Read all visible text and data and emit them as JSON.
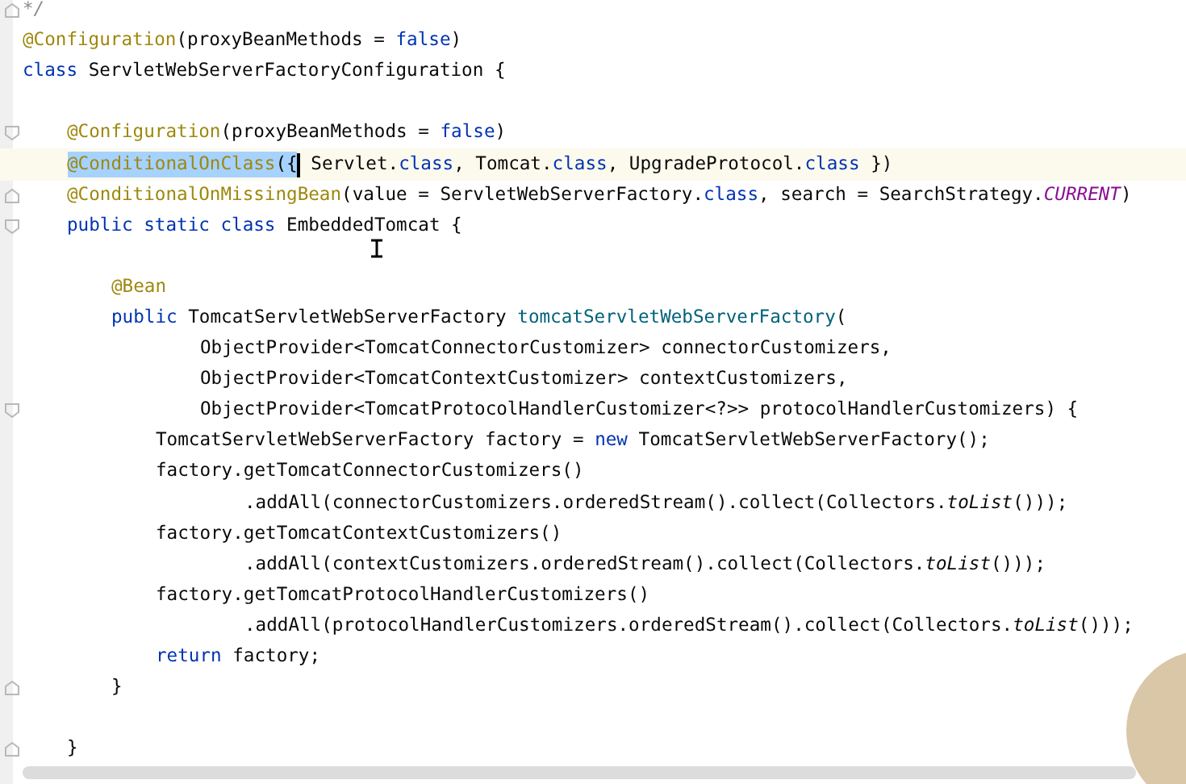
{
  "editor": {
    "lines": [
      {
        "current": false,
        "fold": {
          "kind": "end"
        },
        "tokens": [
          {
            "text": "*/",
            "kind": "comment"
          }
        ]
      },
      {
        "current": false,
        "tokens": [
          {
            "text": "@Configuration",
            "kind": "annotation"
          },
          {
            "text": "(proxyBeanMethods = ",
            "kind": "plain"
          },
          {
            "text": "false",
            "kind": "keyword"
          },
          {
            "text": ")",
            "kind": "plain"
          }
        ]
      },
      {
        "current": false,
        "tokens": [
          {
            "text": "class",
            "kind": "keyword"
          },
          {
            "text": " ServletWebServerFactoryConfiguration {",
            "kind": "plain"
          }
        ],
        "children": [
          {
            "current": false
          },
          {
            "current": false,
            "fold": {
              "kind": "start"
            },
            "tokens": [
              {
                "text": "@Configuration",
                "kind": "annotation"
              },
              {
                "text": "(proxyBeanMethods = ",
                "kind": "plain"
              },
              {
                "text": "false",
                "kind": "keyword"
              },
              {
                "text": ")",
                "kind": "plain"
              }
            ]
          },
          {
            "current": true,
            "selection": [
              {
                "text": "@ConditionalOnClass",
                "kind": "annotation"
              },
              {
                "text": "({",
                "kind": "plain"
              }
            ],
            "tokens": [
              {
                "text": " Servlet.",
                "kind": "plain"
              },
              {
                "text": "class",
                "kind": "keyword"
              },
              {
                "text": ", Tomcat.",
                "kind": "plain"
              },
              {
                "text": "class",
                "kind": "keyword"
              },
              {
                "text": ", UpgradeProtocol.",
                "kind": "plain"
              },
              {
                "text": "class",
                "kind": "keyword"
              },
              {
                "text": " })",
                "kind": "plain"
              }
            ]
          },
          {
            "current": false,
            "fold": {
              "kind": "end"
            },
            "tokens": [
              {
                "text": "@ConditionalOnMissingBean",
                "kind": "annotation"
              },
              {
                "text": "(value = ServletWebServerFactory.",
                "kind": "plain"
              },
              {
                "text": "class",
                "kind": "keyword"
              },
              {
                "text": ", search = SearchStrategy.",
                "kind": "plain"
              },
              {
                "text": "CURRENT",
                "kind": "constant"
              },
              {
                "text": ")",
                "kind": "plain"
              }
            ]
          },
          {
            "current": false,
            "fold": {
              "kind": "start"
            },
            "tokens": [
              {
                "text": "public static class",
                "kind": "keyword"
              },
              {
                "text": " EmbeddedTomcat {",
                "kind": "plain"
              }
            ],
            "children": [
              {
                "current": false
              },
              {
                "current": false,
                "tokens": [
                  {
                    "text": "@Bean",
                    "kind": "annotation"
                  }
                ]
              },
              {
                "current": false,
                "tokens": [
                  {
                    "text": "public",
                    "kind": "keyword"
                  },
                  {
                    "text": " TomcatServletWebServerFactory ",
                    "kind": "plain"
                  },
                  {
                    "text": "tomcatServletWebServerFactory",
                    "kind": "method"
                  },
                  {
                    "text": "(",
                    "kind": "plain"
                  }
                ],
                "continuation": [
                  {
                    "current": false,
                    "tokens": [
                      {
                        "text": "ObjectProvider<TomcatConnectorCustomizer> connectorCustomizers,",
                        "kind": "plain"
                      }
                    ]
                  },
                  {
                    "current": false,
                    "tokens": [
                      {
                        "text": "ObjectProvider<TomcatContextCustomizer> contextCustomizers,",
                        "kind": "plain"
                      }
                    ]
                  },
                  {
                    "current": false,
                    "fold": {
                      "kind": "start"
                    },
                    "tokens": [
                      {
                        "text": "ObjectProvider<TomcatProtocolHandlerCustomizer<?>> protocolHandlerCustomizers) {",
                        "kind": "plain"
                      }
                    ]
                  }
                ],
                "children": [
                  {
                    "current": false,
                    "tokens": [
                      {
                        "text": "TomcatServletWebServerFactory factory = ",
                        "kind": "plain"
                      },
                      {
                        "text": "new",
                        "kind": "keyword"
                      },
                      {
                        "text": " TomcatServletWebServerFactory();",
                        "kind": "plain"
                      }
                    ]
                  },
                  {
                    "current": false,
                    "tokens": [
                      {
                        "text": "factory.getTomcatConnectorCustomizers()",
                        "kind": "plain"
                      }
                    ],
                    "continuation": [
                      {
                        "current": false,
                        "tokens": [
                          {
                            "text": ".addAll(connectorCustomizers.orderedStream().collect(Collectors.",
                            "kind": "plain"
                          },
                          {
                            "text": "toList",
                            "kind": "static-call"
                          },
                          {
                            "text": "()));",
                            "kind": "plain"
                          }
                        ]
                      }
                    ]
                  },
                  {
                    "current": false,
                    "tokens": [
                      {
                        "text": "factory.getTomcatContextCustomizers()",
                        "kind": "plain"
                      }
                    ],
                    "continuation": [
                      {
                        "current": false,
                        "tokens": [
                          {
                            "text": ".addAll(contextCustomizers.orderedStream().collect(Collectors.",
                            "kind": "plain"
                          },
                          {
                            "text": "toList",
                            "kind": "static-call"
                          },
                          {
                            "text": "()));",
                            "kind": "plain"
                          }
                        ]
                      }
                    ]
                  },
                  {
                    "current": false,
                    "tokens": [
                      {
                        "text": "factory.getTomcatProtocolHandlerCustomizers()",
                        "kind": "plain"
                      }
                    ],
                    "continuation": [
                      {
                        "current": false,
                        "tokens": [
                          {
                            "text": ".addAll(protocolHandlerCustomizers.orderedStream().collect(Collectors.",
                            "kind": "plain"
                          },
                          {
                            "text": "toList",
                            "kind": "static-call"
                          },
                          {
                            "text": "()));",
                            "kind": "plain"
                          }
                        ]
                      }
                    ]
                  },
                  {
                    "current": false,
                    "tokens": [
                      {
                        "text": "return",
                        "kind": "keyword"
                      },
                      {
                        "text": " factory;",
                        "kind": "plain"
                      }
                    ]
                  }
                ]
              },
              {
                "current": false,
                "fold": {
                  "kind": "end"
                },
                "tokens": [
                  {
                    "text": "}",
                    "kind": "plain"
                  }
                ]
              }
            ]
          },
          {
            "current": false
          },
          {
            "current": false,
            "fold": {
              "kind": "end"
            },
            "tokens": [
              {
                "text": "}",
                "kind": "plain"
              }
            ]
          }
        ]
      }
    ]
  }
}
